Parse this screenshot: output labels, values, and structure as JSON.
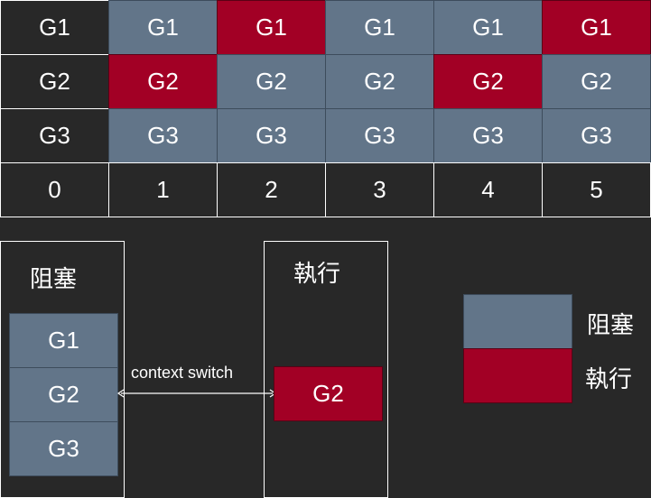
{
  "timeline": {
    "rows": [
      {
        "label": "G1",
        "cells": [
          {
            "text": "G1",
            "state": "blocked"
          },
          {
            "text": "G1",
            "state": "running"
          },
          {
            "text": "G1",
            "state": "blocked"
          },
          {
            "text": "G1",
            "state": "blocked"
          },
          {
            "text": "G1",
            "state": "running"
          }
        ]
      },
      {
        "label": "G2",
        "cells": [
          {
            "text": "G2",
            "state": "running"
          },
          {
            "text": "G2",
            "state": "blocked"
          },
          {
            "text": "G2",
            "state": "blocked"
          },
          {
            "text": "G2",
            "state": "running"
          },
          {
            "text": "G2",
            "state": "blocked"
          }
        ]
      },
      {
        "label": "G3",
        "cells": [
          {
            "text": "G3",
            "state": "blocked"
          },
          {
            "text": "G3",
            "state": "blocked"
          },
          {
            "text": "G3",
            "state": "blocked"
          },
          {
            "text": "G3",
            "state": "blocked"
          },
          {
            "text": "G3",
            "state": "blocked"
          }
        ]
      }
    ],
    "time_labels": [
      "0",
      "1",
      "2",
      "3",
      "4",
      "5"
    ]
  },
  "blocked_box": {
    "title": "阻塞",
    "items": [
      "G1",
      "G2",
      "G3"
    ]
  },
  "context_switch": {
    "label": "context switch"
  },
  "running_box": {
    "title": "執行",
    "item": "G2"
  },
  "legend": {
    "blocked_label": "阻塞",
    "running_label": "執行"
  },
  "colors": {
    "background": "#282828",
    "blocked": "#627589",
    "running": "#a20025",
    "text": "#ffffff"
  }
}
